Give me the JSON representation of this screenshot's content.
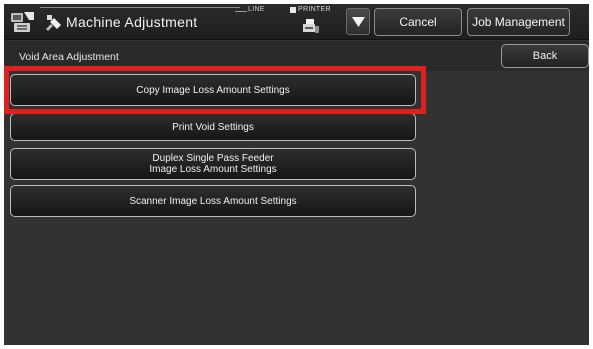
{
  "header": {
    "title": "Machine Adjustment",
    "line_label": "LINE",
    "printer_label": "PRINTER",
    "cancel_label": "Cancel",
    "job_management_label": "Job Management"
  },
  "subheader": {
    "title": "Void Area Adjustment",
    "back_label": "Back"
  },
  "menu": {
    "items": [
      {
        "lines": [
          "Copy Image Loss Amount Settings"
        ]
      },
      {
        "lines": [
          "Print Void Settings"
        ]
      },
      {
        "lines": [
          "Duplex Single Pass Feeder",
          "Image Loss Amount Settings"
        ]
      },
      {
        "lines": [
          "Scanner Image Loss Amount Settings"
        ]
      }
    ]
  },
  "icons": {
    "settings": "settings-icon",
    "title": "machine-adjustment-icon",
    "printer": "printer-icon",
    "dropdown": "chevron-down-icon"
  },
  "colors": {
    "highlight": "#e0201d",
    "background": "#323232"
  }
}
